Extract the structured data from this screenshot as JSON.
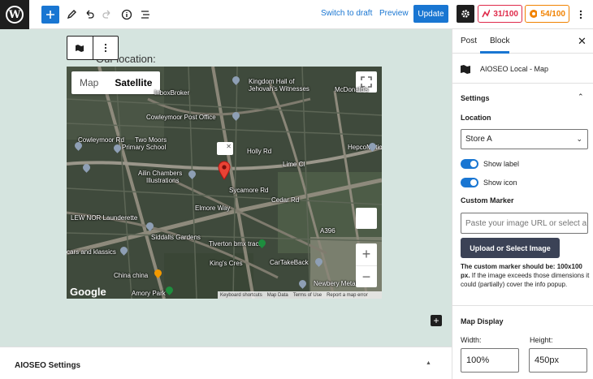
{
  "toolbar": {
    "switch_to_draft": "Switch to draft",
    "preview": "Preview",
    "update": "Update",
    "score_red": "31/100",
    "score_orange": "54/100",
    "colors": {
      "accent": "#1976d2",
      "red": "#df2a4a",
      "orange": "#f18200",
      "dark": "#1e1e1e"
    }
  },
  "editor": {
    "heading": "Our location:",
    "map": {
      "type_map": "Map",
      "type_satellite": "Satellite",
      "attribution": "Google",
      "footer": [
        "Keyboard shortcuts",
        "Map Data",
        "Terms of Use",
        "Report a map error"
      ],
      "labels": [
        "Kingdom Hall of",
        "Jehovah's Witnesses",
        "McDonald's",
        "InboxBroker",
        "Cowleymoor Post Office",
        "Two Moors",
        "Primary School",
        "HepcoMotion",
        "Ailin Chambers",
        "Illustrations",
        "LEW NOR Launderette",
        "Tiverton bmx track",
        "cars and klassics",
        "CarTakeBack",
        "China china",
        "Newbery Metals",
        "Amory Park"
      ],
      "road_labels": [
        "Cowleymoor Rd",
        "Holly Rd",
        "Lime Cl",
        "Cedar Rd",
        "Sycamore Rd",
        "Elmore Way",
        "Siddalls Gardens",
        "King's Cres",
        "A396"
      ]
    },
    "aioseo_panel_title": "AIOSEO Settings"
  },
  "sidebar": {
    "tab_post": "Post",
    "tab_block": "Block",
    "block_name": "AIOSEO Local - Map",
    "settings_title": "Settings",
    "location_label": "Location",
    "location_value": "Store A",
    "show_label": "Show label",
    "show_icon": "Show icon",
    "custom_marker_label": "Custom Marker",
    "marker_placeholder": "Paste your image URL or select a new image",
    "upload_button": "Upload or Select Image",
    "help_bold": "The custom marker should be: 100x100 px.",
    "help_text": " If the image exceeds those dimensions it could (partially) cover the info popup.",
    "map_display_title": "Map Display",
    "width_label": "Width:",
    "width_value": "100%",
    "height_label": "Height:",
    "height_value": "450px"
  }
}
